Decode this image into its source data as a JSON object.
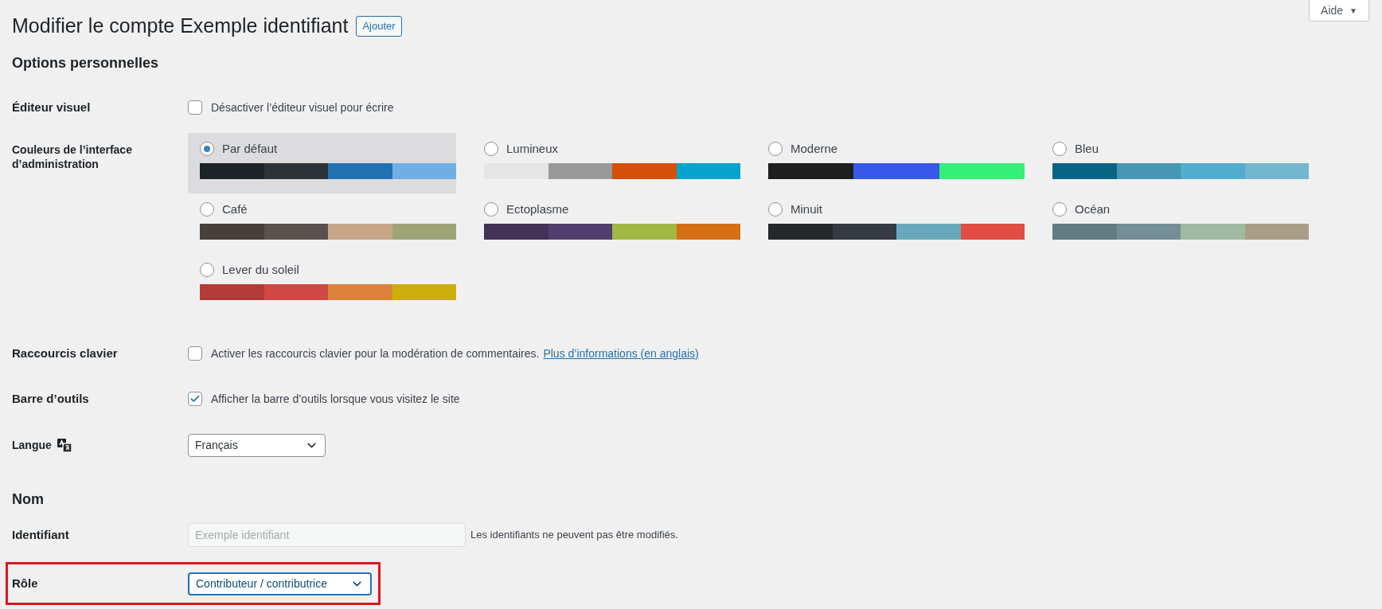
{
  "help_button": {
    "label": "Aide",
    "caret": "▼"
  },
  "title": "Modifier le compte Exemple identifiant",
  "add_button": "Ajouter",
  "section_personal": "Options personnelles",
  "visual_editor": {
    "label": "Éditeur visuel",
    "checkbox_label": "Désactiver l’éditeur visuel pour écrire",
    "checked": false
  },
  "admin_colors": {
    "label": "Couleurs de l’interface d’administration",
    "schemes": [
      {
        "name": "Par défaut",
        "selected": true,
        "swatches": [
          {
            "color": "#1d2327"
          },
          {
            "color": "#2c3338"
          },
          {
            "color": "#2271b1"
          },
          {
            "color": "#72aee6"
          }
        ]
      },
      {
        "name": "Lumineux",
        "selected": false,
        "swatches": [
          {
            "color": "#e5e5e5"
          },
          {
            "color": "#999999"
          },
          {
            "color": "#d64e07"
          },
          {
            "color": "#04a4cc"
          }
        ]
      },
      {
        "name": "Moderne",
        "selected": false,
        "swatches": [
          {
            "color": "#1e1e1e"
          },
          {
            "color": "#3858e9"
          },
          {
            "color": "#33f078"
          }
        ]
      },
      {
        "name": "Bleu",
        "selected": false,
        "swatches": [
          {
            "color": "#096484"
          },
          {
            "color": "#4796b3"
          },
          {
            "color": "#52accc"
          },
          {
            "color": "#74b6ce"
          }
        ]
      },
      {
        "name": "Café",
        "selected": false,
        "swatches": [
          {
            "color": "#46403c"
          },
          {
            "color": "#59524c"
          },
          {
            "color": "#c7a589"
          },
          {
            "color": "#9ea476"
          }
        ]
      },
      {
        "name": "Ectoplasme",
        "selected": false,
        "swatches": [
          {
            "color": "#413256"
          },
          {
            "color": "#523f6d"
          },
          {
            "color": "#a3b745"
          },
          {
            "color": "#d46f15"
          }
        ]
      },
      {
        "name": "Minuit",
        "selected": false,
        "swatches": [
          {
            "color": "#25282b"
          },
          {
            "color": "#363b3f"
          },
          {
            "color": "#69a8bb"
          },
          {
            "color": "#e14d43"
          }
        ]
      },
      {
        "name": "Océan",
        "selected": false,
        "swatches": [
          {
            "color": "#627c83"
          },
          {
            "color": "#738e96"
          },
          {
            "color": "#9ebaa0"
          },
          {
            "color": "#aa9d88"
          }
        ]
      },
      {
        "name": "Lever du soleil",
        "selected": false,
        "swatches": [
          {
            "color": "#b43c38"
          },
          {
            "color": "#cf4944"
          },
          {
            "color": "#dd823b"
          },
          {
            "color": "#ccaf0b"
          }
        ]
      }
    ]
  },
  "keyboard_shortcuts": {
    "label": "Raccourcis clavier",
    "checkbox_label": "Activer les raccourcis clavier pour la modération de commentaires.",
    "link": "Plus d’informations (en anglais)",
    "checked": false
  },
  "toolbar": {
    "label": "Barre d’outils",
    "checkbox_label": "Afficher la barre d’outils lorsque vous visitez le site",
    "checked": true
  },
  "language": {
    "label": "Langue",
    "value": "Français"
  },
  "section_name": "Nom",
  "username": {
    "label": "Identifiant",
    "value": "Exemple identifiant",
    "disabled": true,
    "note": "Les identifiants ne peuvent pas être modifiés."
  },
  "role": {
    "label": "Rôle",
    "value": "Contributeur / contributrice",
    "highlighted": true
  }
}
